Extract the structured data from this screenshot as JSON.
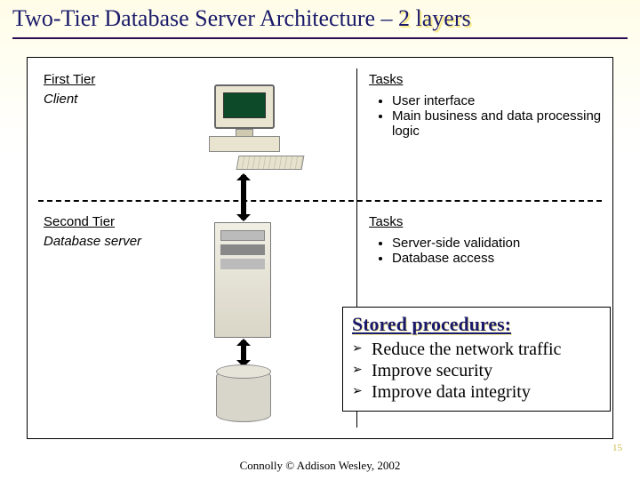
{
  "title_main": "Two-Tier Database Server Architecture – ",
  "title_em": "2 layers",
  "tier1": {
    "heading": "First Tier",
    "sub": "Client",
    "tasks_heading": "Tasks",
    "tasks": [
      "User interface",
      "Main business and data processing logic"
    ]
  },
  "tier2": {
    "heading": "Second Tier",
    "sub": "Database server",
    "tasks_heading": "Tasks",
    "tasks": [
      "Server-side validation",
      "Database access"
    ]
  },
  "stored": {
    "heading": "Stored procedures:",
    "items": [
      "Reduce the network traffic",
      "Improve security",
      "Improve data integrity"
    ]
  },
  "credit": "Connolly © Addison Wesley, 2002",
  "page_number": "15"
}
